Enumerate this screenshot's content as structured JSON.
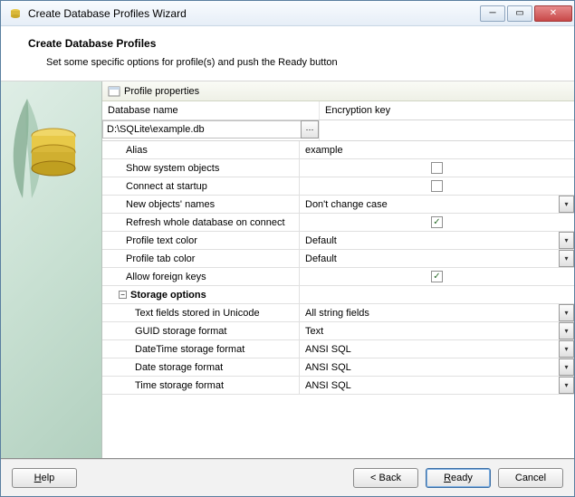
{
  "titlebar": {
    "title": "Create Database Profiles Wizard"
  },
  "header": {
    "title": "Create Database Profiles",
    "subtitle": "Set some specific options for profile(s) and push the Ready button"
  },
  "section_header": "Profile properties",
  "labels": {
    "database_name": "Database name",
    "encryption_key": "Encryption key",
    "storage_options": "Storage options"
  },
  "database_path": "D:\\SQLite\\example.db",
  "encryption_key_value": "",
  "props": {
    "alias": {
      "label": "Alias",
      "value": "example"
    },
    "show_sys": {
      "label": "Show system objects",
      "checked": false
    },
    "connect_startup": {
      "label": "Connect at startup",
      "checked": false
    },
    "new_obj_names": {
      "label": "New objects' names",
      "value": "Don't change case"
    },
    "refresh_db": {
      "label": "Refresh whole database on connect",
      "checked": true
    },
    "text_color": {
      "label": "Profile text color",
      "value": "Default"
    },
    "tab_color": {
      "label": "Profile tab color",
      "value": "Default"
    },
    "allow_fk": {
      "label": "Allow foreign keys",
      "checked": true
    }
  },
  "storage": {
    "text_unicode": {
      "label": "Text fields stored in Unicode",
      "value": "All string fields"
    },
    "guid": {
      "label": "GUID storage format",
      "value": "Text"
    },
    "datetime": {
      "label": "DateTime storage format",
      "value": "ANSI SQL"
    },
    "date": {
      "label": "Date storage format",
      "value": "ANSI SQL"
    },
    "time": {
      "label": "Time storage format",
      "value": "ANSI SQL"
    }
  },
  "buttons": {
    "help": "Help",
    "back": "< Back",
    "ready": "Ready",
    "cancel": "Cancel"
  }
}
